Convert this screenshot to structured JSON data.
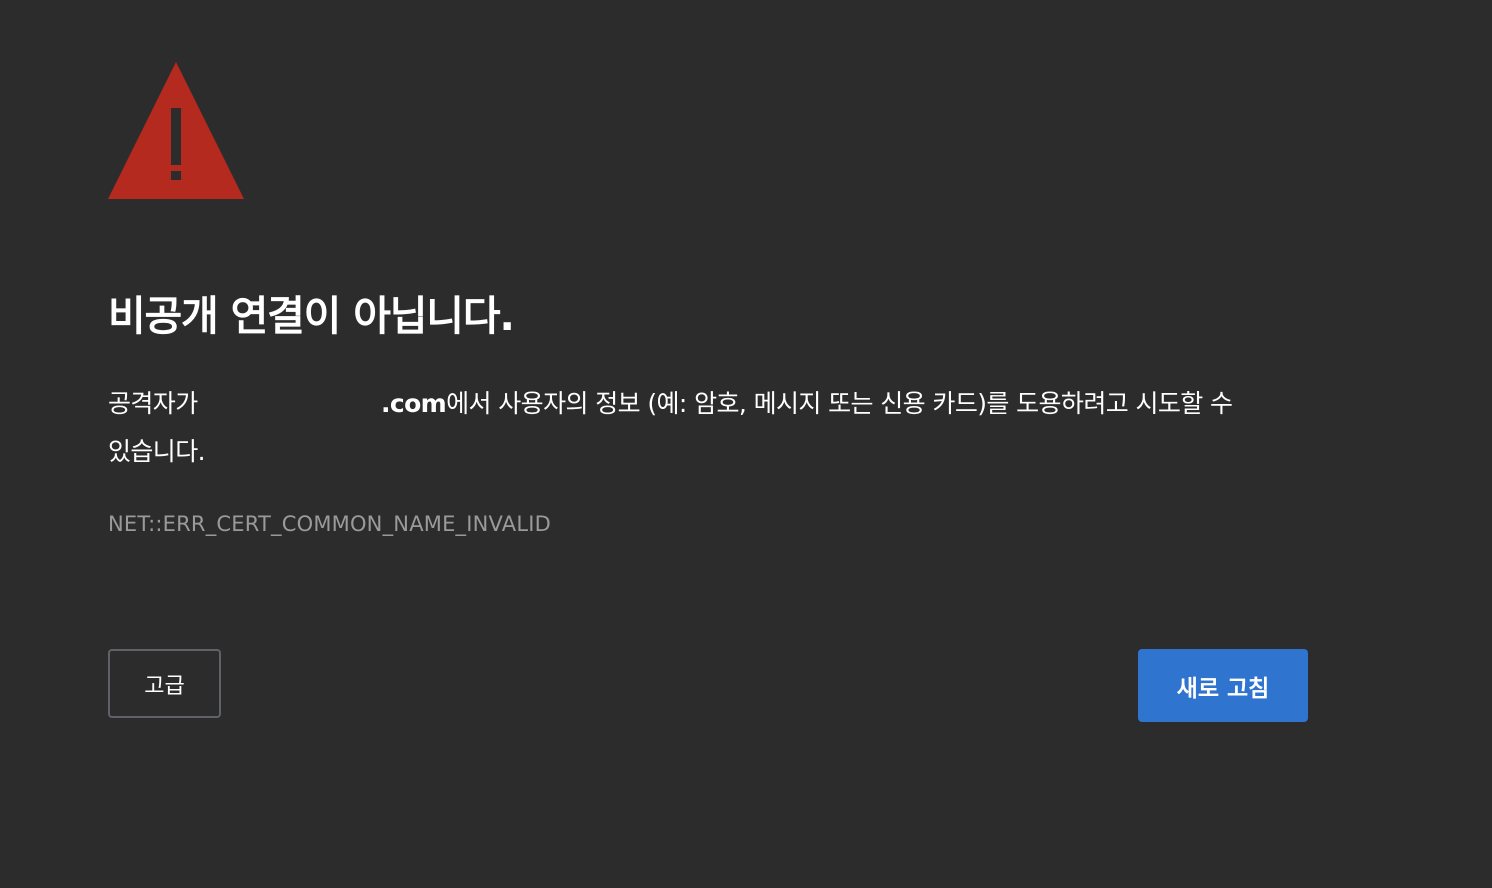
{
  "page": {
    "title": "비공개 연결이 아닙니다.",
    "description": {
      "prefix": "공격자가",
      "domain_suffix": ".com",
      "rest_line1": "에서 사용자의 정보 (예: 암호, 메시지 또는 신용 카드)를 도용하려고 시도할 수",
      "rest_line2": "있습니다."
    },
    "error_code": "NET::ERR_CERT_COMMON_NAME_INVALID"
  },
  "buttons": {
    "advanced_label": "고급",
    "reload_label": "새로 고침"
  },
  "icons": {
    "warning": "warning-triangle-icon"
  },
  "colors": {
    "background": "#2c2c2c",
    "warning_red": "#b52a1e",
    "primary_blue": "#2f74cf",
    "error_code_gray": "#9a9a9a"
  }
}
